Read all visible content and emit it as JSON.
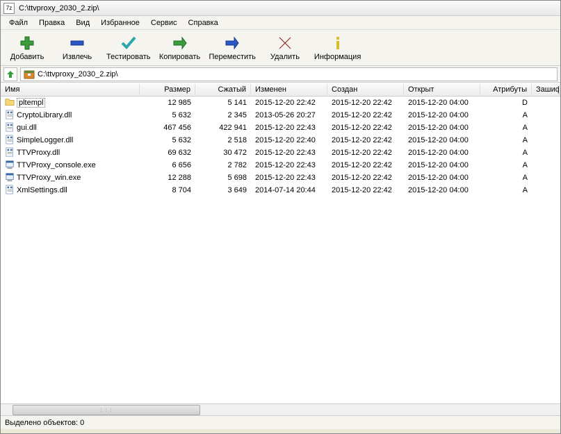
{
  "window": {
    "title": "C:\\ttvproxy_2030_2.zip\\"
  },
  "menu": {
    "file": "Файл",
    "edit": "Правка",
    "view": "Вид",
    "favorites": "Избранное",
    "service": "Сервис",
    "help": "Справка"
  },
  "toolbar": {
    "add": "Добавить",
    "extract": "Извлечь",
    "test": "Тестировать",
    "copy": "Копировать",
    "move": "Переместить",
    "delete": "Удалить",
    "info": "Информация"
  },
  "address": {
    "path": "C:\\ttvproxy_2030_2.zip\\"
  },
  "columns": {
    "name": "Имя",
    "size": "Размер",
    "packed": "Сжатый",
    "modified": "Изменен",
    "created": "Создан",
    "opened": "Открыт",
    "attributes": "Атрибуты",
    "encrypted": "Зашиф"
  },
  "files": [
    {
      "name": "pltempl",
      "type": "folder",
      "size": "12 985",
      "packed": "5 141",
      "modified": "2015-12-20 22:42",
      "created": "2015-12-20 22:42",
      "opened": "2015-12-20 04:00",
      "attr": "D",
      "selected": true
    },
    {
      "name": "CryptoLibrary.dll",
      "type": "dll",
      "size": "5 632",
      "packed": "2 345",
      "modified": "2013-05-26 20:27",
      "created": "2015-12-20 22:42",
      "opened": "2015-12-20 04:00",
      "attr": "A"
    },
    {
      "name": "gui.dll",
      "type": "dll",
      "size": "467 456",
      "packed": "422 941",
      "modified": "2015-12-20 22:43",
      "created": "2015-12-20 22:42",
      "opened": "2015-12-20 04:00",
      "attr": "A"
    },
    {
      "name": "SimpleLogger.dll",
      "type": "dll",
      "size": "5 632",
      "packed": "2 518",
      "modified": "2015-12-20 22:40",
      "created": "2015-12-20 22:42",
      "opened": "2015-12-20 04:00",
      "attr": "A"
    },
    {
      "name": "TTVProxy.dll",
      "type": "dll",
      "size": "69 632",
      "packed": "30 472",
      "modified": "2015-12-20 22:43",
      "created": "2015-12-20 22:42",
      "opened": "2015-12-20 04:00",
      "attr": "A"
    },
    {
      "name": "TTVProxy_console.exe",
      "type": "exe",
      "size": "6 656",
      "packed": "2 782",
      "modified": "2015-12-20 22:43",
      "created": "2015-12-20 22:42",
      "opened": "2015-12-20 04:00",
      "attr": "A"
    },
    {
      "name": "TTVProxy_win.exe",
      "type": "exe",
      "size": "12 288",
      "packed": "5 698",
      "modified": "2015-12-20 22:43",
      "created": "2015-12-20 22:42",
      "opened": "2015-12-20 04:00",
      "attr": "A"
    },
    {
      "name": "XmlSettings.dll",
      "type": "dll",
      "size": "8 704",
      "packed": "3 649",
      "modified": "2014-07-14 20:44",
      "created": "2015-12-20 22:42",
      "opened": "2015-12-20 04:00",
      "attr": "A"
    }
  ],
  "status": {
    "text": "Выделено объектов: 0"
  }
}
